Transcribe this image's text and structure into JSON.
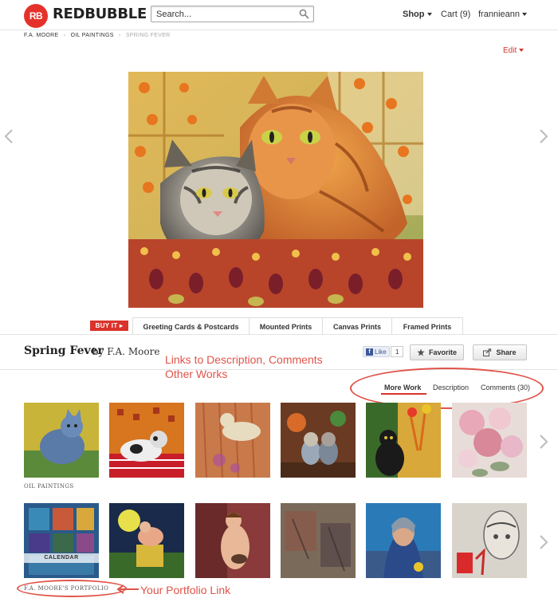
{
  "header": {
    "logo_mark": "RB",
    "logo_text": "REDBUBBLE",
    "search_placeholder": "Search...",
    "nav": {
      "shop": "Shop",
      "cart": "Cart (9)",
      "user": "frannieann"
    }
  },
  "breadcrumb": {
    "items": [
      "F.A. MOORE",
      "OIL PAINTINGS",
      "SPRING FEVER"
    ]
  },
  "edit_label": "Edit",
  "buy": {
    "buy_it_label": "BUY IT",
    "products": [
      "Greeting Cards & Postcards",
      "Mounted Prints",
      "Canvas Prints",
      "Framed Prints"
    ]
  },
  "work": {
    "title": "Spring Fever",
    "byline": "by F.A. Moore",
    "fb_like_label": "Like",
    "fb_like_count": "1",
    "favorite_label": "Favorite",
    "share_label": "Share"
  },
  "tabs": {
    "more_work": "More Work",
    "description": "Description",
    "comments": "Comments (30)"
  },
  "sections": {
    "oil_paintings": "OIL PAINTINGS",
    "calendar": "CALENDAR",
    "portfolio": "F.A. MOORE'S PORTFOLIO"
  },
  "annotations": {
    "line1": "Links to Description, Comments",
    "line2": "Other Works",
    "portfolio": "Your Portfolio Link"
  },
  "colors": {
    "brand_red": "#e4322b",
    "annotation_red": "#e0544a",
    "facebook_blue": "#3b5998"
  }
}
